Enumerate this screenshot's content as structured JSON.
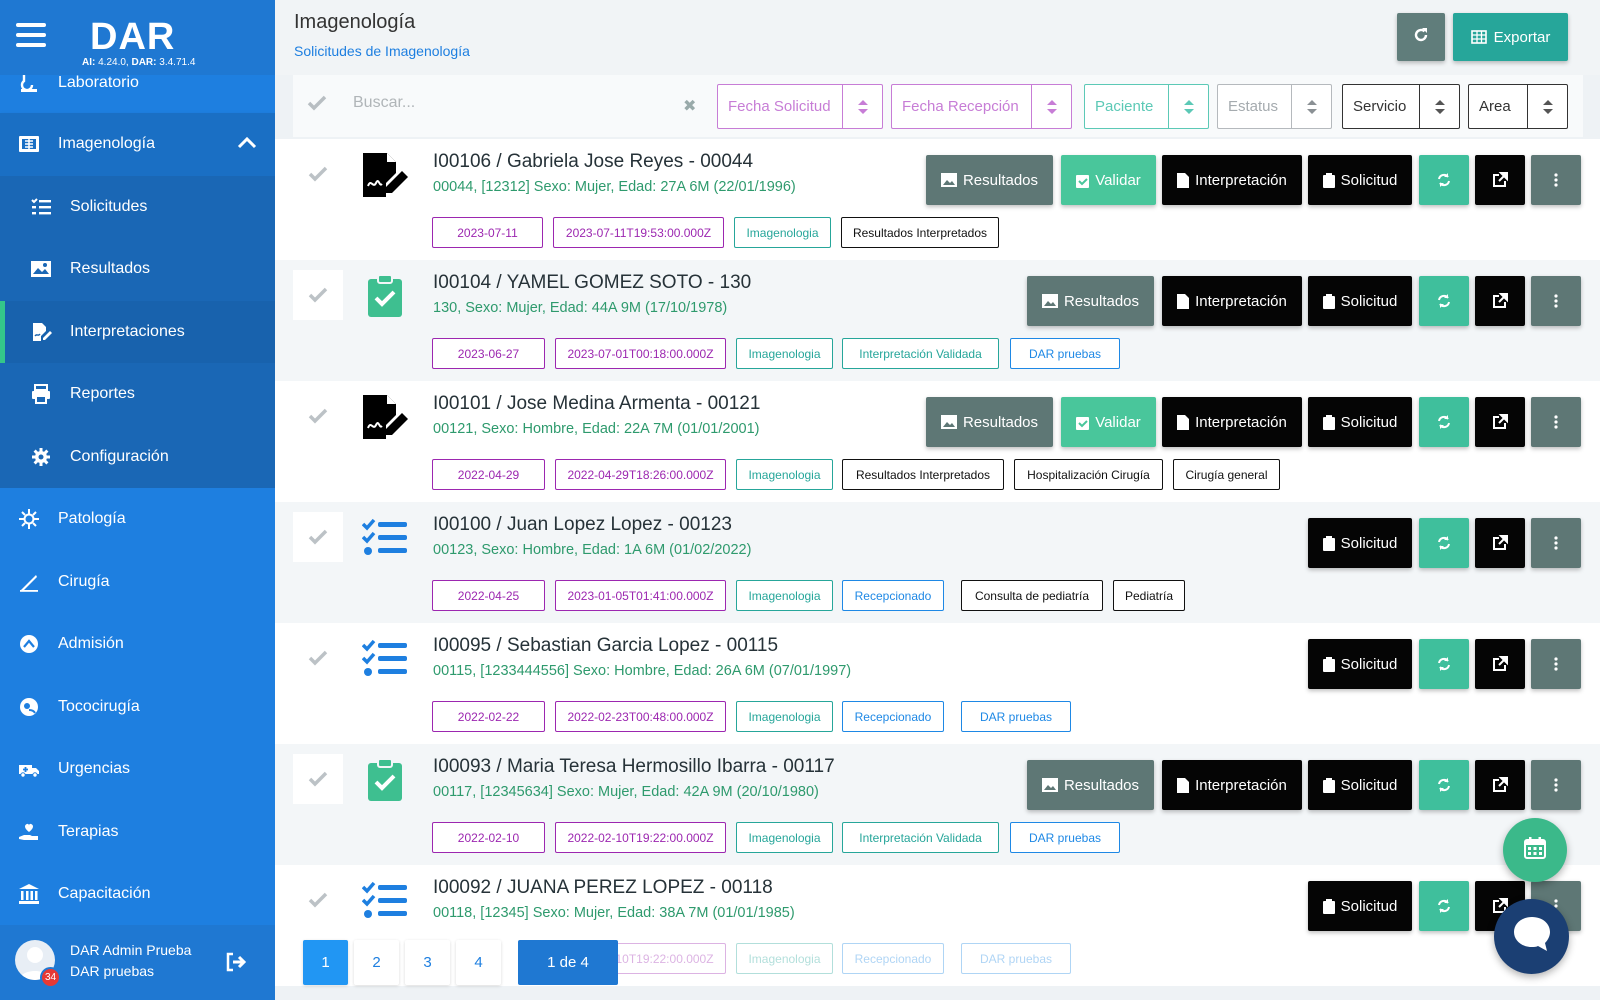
{
  "brand": {
    "logo": "DAR",
    "version_ai_label": "AI:",
    "version_ai": " 4.24.0, ",
    "version_dar_label": "DAR:",
    "version_dar": " 3.4.71.4"
  },
  "sidebar": {
    "items": [
      {
        "label": "Laboratorio",
        "icon": "flask-icon"
      },
      {
        "label": "Imagenología",
        "icon": "xray-icon"
      },
      {
        "label": "Solicitudes",
        "icon": "list-icon"
      },
      {
        "label": "Resultados",
        "icon": "image-icon"
      },
      {
        "label": "Interpretaciones",
        "icon": "sign-icon"
      },
      {
        "label": "Reportes",
        "icon": "print-icon"
      },
      {
        "label": "Configuración",
        "icon": "gear-icon"
      },
      {
        "label": "Patología",
        "icon": "virus-icon"
      },
      {
        "label": "Cirugía",
        "icon": "scalpel-icon"
      },
      {
        "label": "Admisión",
        "icon": "admission-icon"
      },
      {
        "label": "Tococirugía",
        "icon": "baby-icon"
      },
      {
        "label": "Urgencias",
        "icon": "ambulance-icon"
      },
      {
        "label": "Terapias",
        "icon": "heart-hand-icon"
      },
      {
        "label": "Capacitación",
        "icon": "bank-icon"
      }
    ]
  },
  "user": {
    "name": "DAR Admin Prueba",
    "org": "DAR pruebas",
    "notifications": "34"
  },
  "header": {
    "title": "Imagenología",
    "breadcrumb": "Solicitudes de Imagenología",
    "export_label": "Exportar"
  },
  "filters": {
    "search_placeholder": "Buscar...",
    "clear": "✖",
    "fecha_solicitud": "Fecha Solicitud",
    "fecha_recepcion": "Fecha Recepción",
    "paciente": "Paciente",
    "estatus": "Estatus",
    "servicio": "Servicio",
    "area": "Area"
  },
  "buttons": {
    "resultados": "Resultados",
    "validar": "Validar",
    "interpretacion": "Interpretación",
    "solicitud": "Solicitud"
  },
  "colors": {
    "primary": "#1e7fe0",
    "sidebar_sub": "#1a67b5",
    "green": "#49c69b",
    "gray": "#5e7775",
    "teal": "#26a69a"
  },
  "rows": [
    {
      "title": "I00106 / Gabriela Jose Reyes - 00044",
      "sub": "00044, [12312] Sexo: Mujer, Edad: 27A 6M (22/01/1996)",
      "status_icon": "signature-icon",
      "tags": [
        "2023-07-11",
        "2023-07-11T19:53:00.000Z",
        "Imagenologia",
        "Resultados Interpretados"
      ]
    },
    {
      "title": "I00104 / YAMEL GOMEZ SOTO - 130",
      "sub": "130, Sexo: Mujer, Edad: 44A 9M (17/10/1978)",
      "status_icon": "clipboard-check-icon",
      "tags": [
        "2023-06-27",
        "2023-07-01T00:18:00.000Z",
        "Imagenologia",
        "Interpretación Validada",
        "DAR pruebas"
      ]
    },
    {
      "title": "I00101 / Jose Medina Armenta - 00121",
      "sub": "00121, Sexo: Hombre, Edad: 22A 7M (01/01/2001)",
      "status_icon": "signature-icon",
      "tags": [
        "2022-04-29",
        "2022-04-29T18:26:00.000Z",
        "Imagenologia",
        "Resultados Interpretados",
        "Hospitalización Cirugía",
        "Cirugía general"
      ]
    },
    {
      "title": "I00100 / Juan Lopez Lopez - 00123",
      "sub": "00123, Sexo: Hombre, Edad: 1A 6M (01/02/2022)",
      "status_icon": "checklist-icon",
      "tags": [
        "2022-04-25",
        "2023-01-05T01:41:00.000Z",
        "Imagenologia",
        "Recepcionado",
        "Consulta de pediatría",
        "Pediatría"
      ]
    },
    {
      "title": "I00095 / Sebastian Garcia Lopez - 00115",
      "sub": "00115, [1233444556] Sexo: Hombre, Edad: 26A 6M (07/01/1997)",
      "status_icon": "checklist-icon",
      "tags": [
        "2022-02-22",
        "2022-02-23T00:48:00.000Z",
        "Imagenologia",
        "Recepcionado",
        "DAR pruebas"
      ]
    },
    {
      "title": "I00093 / Maria Teresa Hermosillo Ibarra - 00117",
      "sub": "00117, [12345634] Sexo: Mujer, Edad: 42A 9M (20/10/1980)",
      "status_icon": "clipboard-check-icon",
      "tags": [
        "2022-02-10",
        "2022-02-10T19:22:00.000Z",
        "Imagenologia",
        "Interpretación Validada",
        "DAR pruebas"
      ]
    },
    {
      "title": "I00092 / JUANA PEREZ LOPEZ - 00118",
      "sub": "00118, [12345] Sexo: Mujer, Edad: 38A 7M (01/01/1985)",
      "status_icon": "checklist-icon",
      "tags": [
        "",
        "2022-02-10T19:22:00.000Z",
        "Imagenologia",
        "Recepcionado",
        "DAR pruebas"
      ]
    }
  ],
  "pagination": {
    "pages": [
      "1",
      "2",
      "3",
      "4"
    ],
    "info": "1 de 4"
  }
}
